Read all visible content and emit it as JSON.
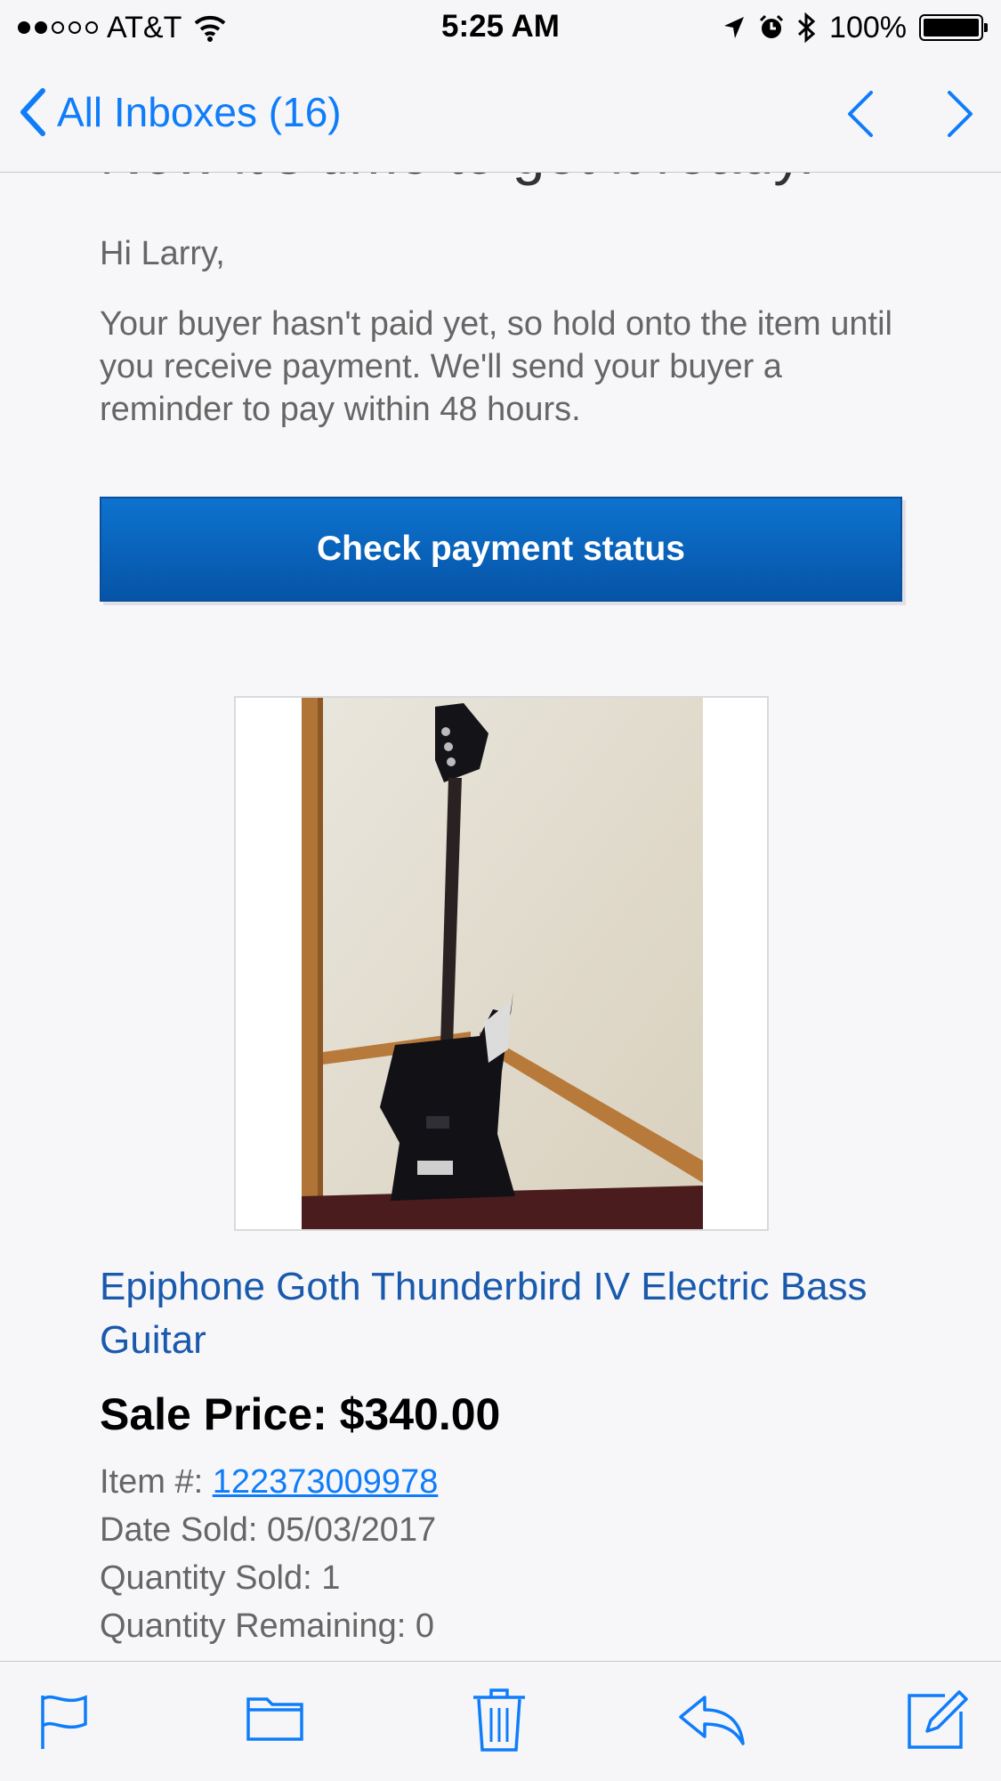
{
  "status_bar": {
    "carrier": "AT&T",
    "time": "5:25 AM",
    "battery": "100%"
  },
  "nav": {
    "back_label": "All Inboxes (16)"
  },
  "email": {
    "headline": "Now it's time to get it ready.",
    "greeting": "Hi Larry,",
    "body": "Your buyer hasn't paid yet, so hold onto the item until you receive payment. We'll send your buyer a reminder to pay within 48 hours.",
    "cta_label": "Check payment status",
    "item_title": "Epiphone Goth Thunderbird IV Electric Bass Guitar",
    "sale_price": "Sale Price: $340.00",
    "item_number_label": "Item #:",
    "item_number": "122373009978",
    "date_sold": "Date Sold: 05/03/2017",
    "quantity_sold": "Quantity Sold: 1",
    "quantity_remaining": "Quantity Remaining: 0"
  },
  "toolbar": {
    "icons": [
      "flag-icon",
      "folder-icon",
      "trash-icon",
      "reply-icon",
      "compose-icon"
    ]
  },
  "colors": {
    "link": "#0f7dfa",
    "item_title": "#1a5aad",
    "cta": "#0654a6"
  }
}
